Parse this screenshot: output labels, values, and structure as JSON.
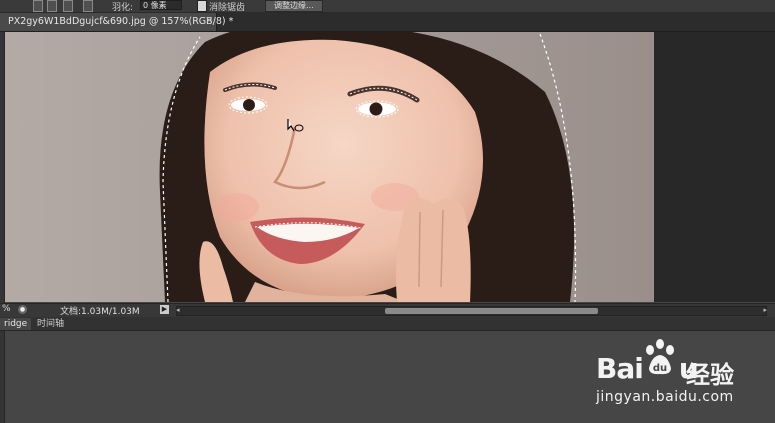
{
  "options_bar": {
    "feather_label": "羽化:",
    "feather_value": "0 像素",
    "antialias_label": "消除锯齿",
    "refine_edge_button": "调整边缘..."
  },
  "document_tab": {
    "title": "PX2gy6W1BdDgujcf&690.jpg @ 157%(RGB/8) *",
    "close": "×"
  },
  "status_bar": {
    "zoom": "%",
    "doc_info": "文档:1.03M/1.03M",
    "menu_arrow": "▶"
  },
  "panel_tabs": [
    {
      "label": "ridge",
      "active": true
    },
    {
      "label": "时间轴",
      "active": false
    }
  ],
  "watermark": {
    "brand": "Bai",
    "brand_tail": "u",
    "chinese": "经验",
    "url": "jingyan.baidu.com"
  },
  "colors": {
    "workspace": "#464646",
    "canvas_bg": "#282828",
    "selection": "#ffffff"
  }
}
